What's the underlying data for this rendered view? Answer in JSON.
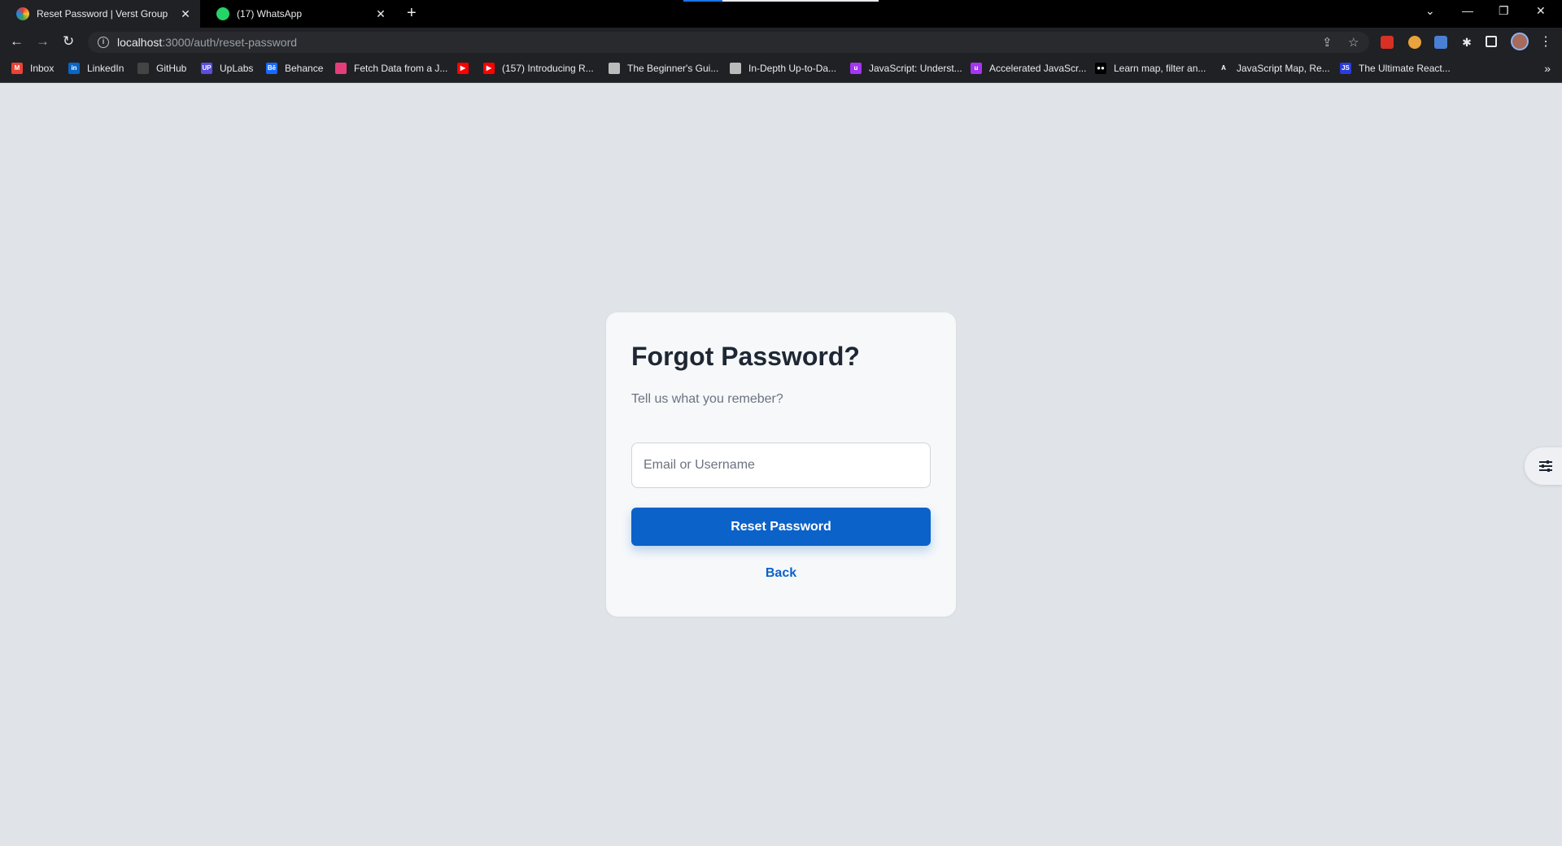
{
  "browser": {
    "tabs": [
      {
        "title": "Reset Password | Verst Group",
        "close": "✕"
      },
      {
        "title": "(17) WhatsApp",
        "close": "✕"
      }
    ],
    "new_tab": "+",
    "window_controls": {
      "dropdown": "⌄",
      "minimize": "—",
      "restore": "❐",
      "close": "✕"
    },
    "nav": {
      "back": "←",
      "forward": "→",
      "reload": "↻"
    },
    "url": {
      "host": "localhost",
      "path": ":3000/auth/reset-password"
    },
    "omnibox_icons": {
      "share": "⇪",
      "star": "☆"
    },
    "bookmarks": [
      {
        "label": "Inbox",
        "icon": "gmail-icon",
        "color": "#ea4335",
        "glyph": "M"
      },
      {
        "label": "LinkedIn",
        "icon": "linkedin-icon",
        "color": "#0a66c2",
        "glyph": "in"
      },
      {
        "label": "GitHub",
        "icon": "github-icon",
        "color": "#444",
        "glyph": ""
      },
      {
        "label": "UpLabs",
        "icon": "uplabs-icon",
        "color": "#5a4de0",
        "glyph": "UP"
      },
      {
        "label": "Behance",
        "icon": "behance-icon",
        "color": "#1769ff",
        "glyph": "Bē"
      },
      {
        "label": "Fetch Data from a J...",
        "icon": "circle-icon",
        "color": "#e33e7a",
        "glyph": ""
      },
      {
        "label": "",
        "icon": "youtube-icon",
        "color": "#ff0000",
        "glyph": "▶"
      },
      {
        "label": "(157) Introducing R...",
        "icon": "youtube-icon",
        "color": "#ff0000",
        "glyph": "▶"
      },
      {
        "label": "The Beginner's Gui...",
        "icon": "ghost-icon",
        "color": "#bbb",
        "glyph": ""
      },
      {
        "label": "In-Depth Up-to-Da...",
        "icon": "ghost-icon",
        "color": "#bbb",
        "glyph": ""
      },
      {
        "label": "JavaScript: Underst...",
        "icon": "udemy-icon",
        "color": "#a435f0",
        "glyph": "u"
      },
      {
        "label": "Accelerated JavaScr...",
        "icon": "udemy-icon",
        "color": "#a435f0",
        "glyph": "u"
      },
      {
        "label": "Learn map, filter an...",
        "icon": "medium-icon",
        "color": "#fff",
        "glyph": "●●"
      },
      {
        "label": "JavaScript Map, Re...",
        "icon": "angular-icon",
        "color": "#202124",
        "glyph": "A"
      },
      {
        "label": "The Ultimate React...",
        "icon": "js-icon",
        "color": "#2b3dd8",
        "glyph": "JS"
      }
    ],
    "bookmarks_more": "»"
  },
  "card": {
    "title": "Forgot Password?",
    "subtitle": "Tell us what you remeber?",
    "email_placeholder": "Email or Username",
    "reset_button": "Reset Password",
    "back_link": "Back"
  },
  "colors": {
    "primary": "#0b62c9",
    "page_bg": "#e0e3e8",
    "card_bg": "#f6f8fa"
  }
}
